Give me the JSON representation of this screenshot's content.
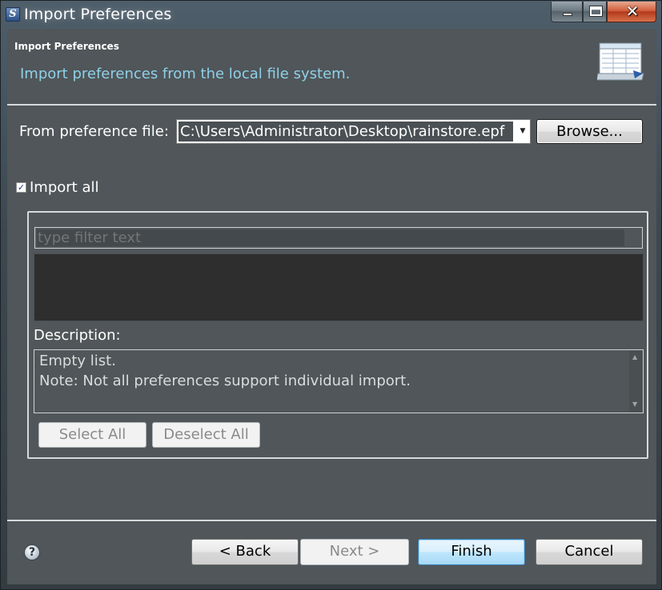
{
  "window": {
    "title": "Import Preferences",
    "app_icon_glyph": "S"
  },
  "header": {
    "title": "Import Preferences",
    "message": "Import preferences from the local file system.",
    "banner_icon": "import-wizard-banner-icon"
  },
  "source": {
    "label": "From preference file:",
    "file_path": "C:\\Users\\Administrator\\Desktop\\rainstore.epf",
    "browse_label": "Browse..."
  },
  "import_all": {
    "label": "Import all",
    "checked": true
  },
  "group": {
    "filter_placeholder": "type filter text",
    "description_label": "Description:",
    "description_lines": [
      "Empty list.",
      "Note: Not all preferences support individual import."
    ],
    "select_all_label": "Select All",
    "deselect_all_label": "Deselect All"
  },
  "footer": {
    "help_icon": "help-icon",
    "back_label": "< Back",
    "next_label": "Next >",
    "finish_label": "Finish",
    "cancel_label": "Cancel"
  },
  "colors": {
    "client_bg": "#505659",
    "header_message": "#8fd0e8",
    "close_button": "#c84a28"
  }
}
